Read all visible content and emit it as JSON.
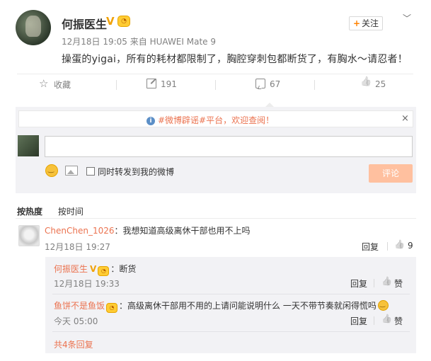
{
  "post": {
    "author": "何振医生",
    "verified_mark": "V",
    "timestamp": "12月18日 19:05",
    "source": "来自 HUAWEI Mate 9",
    "follow_label": "关注",
    "text": "操蛋的yigai，所有的耗材都限制了，胸腔穿刺包都断货了，有胸水～请忍者！"
  },
  "actions": {
    "favorite_label": "收藏",
    "repost_count": "191",
    "comment_count": "67",
    "like_count": "25"
  },
  "comment_box": {
    "notice": "#微博辟谣#平台，欢迎查阅！",
    "close": "×",
    "input_value": "",
    "repost_checkbox_label": "同时转发到我的微博",
    "submit_label": "评论"
  },
  "sort_tabs": [
    "按热度",
    "按时间"
  ],
  "comments": [
    {
      "user": "ChenChen_1026",
      "text": "：我想知道高级离休干部也用不上吗",
      "time": "12月18日 19:27",
      "reply_label": "回复",
      "likes": "9"
    }
  ],
  "replies": [
    {
      "user": "何振医生",
      "verified_mark": "V",
      "text": "：断货",
      "time": "12月18日 19:33",
      "reply_label": "回复",
      "like_label": "赞"
    },
    {
      "user": "鱼饼不是鱼饭",
      "text": "：高级离休干部用不用的上请问能说明什么 一天不带节奏就闲得慌吗",
      "time": "今天 05:00",
      "reply_label": "回复",
      "like_label": "赞"
    }
  ],
  "more_replies": "共4条回复",
  "colors": {
    "accent": "#eb7350",
    "submit_disabled": "#ffc09f",
    "verified": "#f0a20a"
  }
}
